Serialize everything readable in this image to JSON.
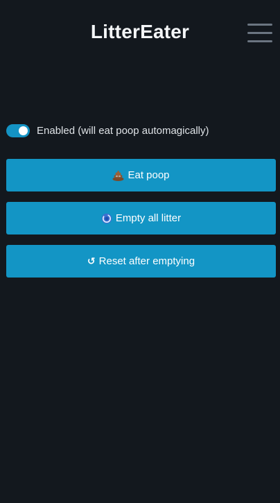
{
  "header": {
    "title": "LitterEater",
    "menu_icon": "hamburger-menu-icon"
  },
  "toggle": {
    "label": "Enabled (will eat poop automagically)",
    "checked": true
  },
  "buttons": {
    "eat": {
      "icon": "poop-icon",
      "label": "Eat poop"
    },
    "empty": {
      "icon": "swirl-icon",
      "label": "Empty all litter"
    },
    "reset": {
      "icon": "counterclockwise-arrow-icon",
      "glyph": "↺",
      "label": "Reset after emptying"
    }
  },
  "colors": {
    "background": "#13181e",
    "accent": "#1395c5",
    "text": "#e6e9ec",
    "menu_bars": "#6b7581"
  }
}
